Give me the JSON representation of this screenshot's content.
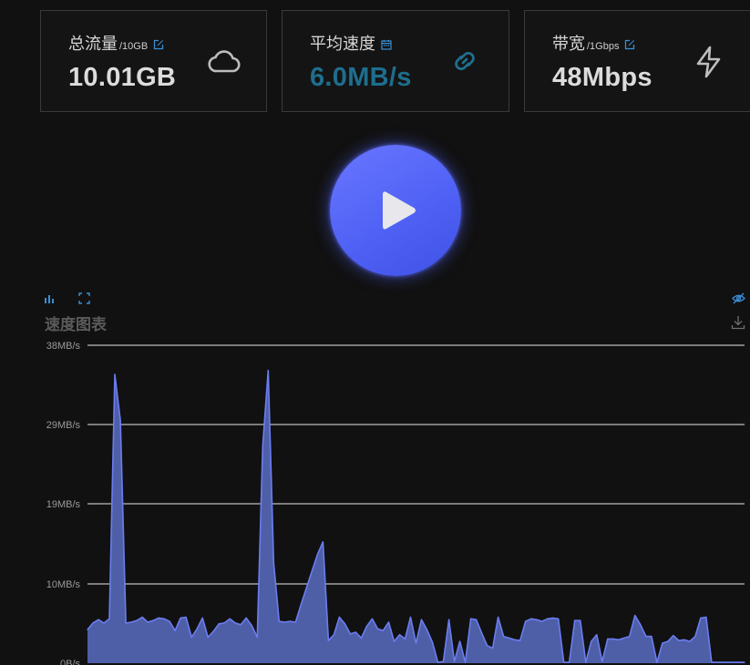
{
  "stats": [
    {
      "label": "总流量",
      "sub": "/10GB",
      "value": "10.01GB",
      "icon": "cloud-icon",
      "edit_icon": "edit-icon"
    },
    {
      "label": "平均速度",
      "sub": "",
      "value": "6.0MB/s",
      "icon": "link-icon",
      "edit_icon": "calendar-icon"
    },
    {
      "label": "带宽",
      "sub": "/1Gbps",
      "value": "48Mbps",
      "icon": "lightning-icon",
      "edit_icon": "edit-icon"
    }
  ],
  "colors": {
    "accent_value": "#1e6e8e",
    "edit_icon": "#3b8fd6",
    "play_button": "#5062f5",
    "area_fill": "#4e5fa8",
    "area_stroke": "#6b7df0",
    "grid": "#e6e6e6"
  },
  "play_button": {
    "icon": "play-icon"
  },
  "chart_panel": {
    "title": "速度图表",
    "tools": [
      "bar-chart-icon",
      "fullscreen-icon",
      "eye-hidden-icon",
      "download-icon"
    ]
  },
  "chart_data": {
    "type": "area",
    "title": "速度图表",
    "xlabel": "",
    "ylabel": "",
    "unit": "MB/s",
    "y_ticks": [
      "0B/s",
      "10MB/s",
      "19MB/s",
      "29MB/s",
      "38MB/s"
    ],
    "ylim": [
      0,
      38
    ],
    "grid": true,
    "x": [
      0,
      1,
      2,
      3,
      4,
      5,
      6,
      7,
      8,
      9,
      10,
      11,
      12,
      13,
      14,
      15,
      16,
      17,
      18,
      19,
      20,
      21,
      22,
      23,
      24,
      25,
      26,
      27,
      28,
      29,
      30,
      31,
      32,
      33,
      34,
      35,
      36,
      37,
      38,
      39,
      40,
      41,
      42,
      43,
      44,
      45,
      46,
      47,
      48,
      49,
      50,
      51,
      52,
      53,
      54,
      55,
      56,
      57,
      58,
      59,
      60,
      61,
      62,
      63,
      64,
      65,
      66,
      67,
      68,
      69,
      70,
      71,
      72,
      73,
      74,
      75,
      76,
      77,
      78,
      79,
      80,
      81,
      82,
      83,
      84,
      85,
      86,
      87,
      88,
      89,
      90,
      91,
      92,
      93,
      94,
      95,
      96,
      97,
      98,
      99,
      100,
      101,
      102,
      103,
      104,
      105,
      106,
      107,
      108,
      109,
      110,
      111,
      112,
      113,
      114,
      115,
      116,
      117,
      118,
      119,
      120
    ],
    "series": [
      {
        "values": [
          4,
          4.8,
          5.2,
          4.8,
          5.3,
          34.5,
          29,
          4.8,
          4.9,
          5.1,
          5.5,
          4.9,
          5.1,
          5.4,
          5.3,
          5,
          3.9,
          5.4,
          5.5,
          3.1,
          4.1,
          5.4,
          3.1,
          3.8,
          4.7,
          4.8,
          5.3,
          4.8,
          4.6,
          5.4,
          4.5,
          3.1,
          26,
          35,
          12,
          5,
          4.9,
          5,
          4.9,
          7,
          9,
          11,
          13,
          14.5,
          2.7,
          3.4,
          5.5,
          4.7,
          3.5,
          3.7,
          3,
          4.4,
          5.3,
          4.1,
          3.9,
          4.9,
          2.6,
          3.4,
          2.9,
          5.5,
          2.4,
          5.2,
          4,
          2.5,
          0.1,
          0.2,
          5.2,
          0.2,
          2.6,
          0.1,
          5.3,
          5.2,
          3.6,
          2.1,
          1.8,
          5.5,
          3.2,
          3,
          2.8,
          2.7,
          5,
          5.3,
          5.2,
          5,
          5.3,
          5.4,
          5.3,
          0.1,
          0.1,
          5.1,
          5.1,
          0.1,
          2.6,
          3.4,
          0.2,
          2.9,
          2.9,
          2.8,
          3,
          3.2,
          5.7,
          4.6,
          3.2,
          3.2,
          0.1,
          2.4,
          2.6,
          3.3,
          2.7,
          2.8,
          2.6,
          3.2,
          5.4,
          5.5,
          0.1,
          0.1,
          0.1,
          0.1,
          0.1,
          0.1,
          0.1
        ]
      }
    ]
  }
}
